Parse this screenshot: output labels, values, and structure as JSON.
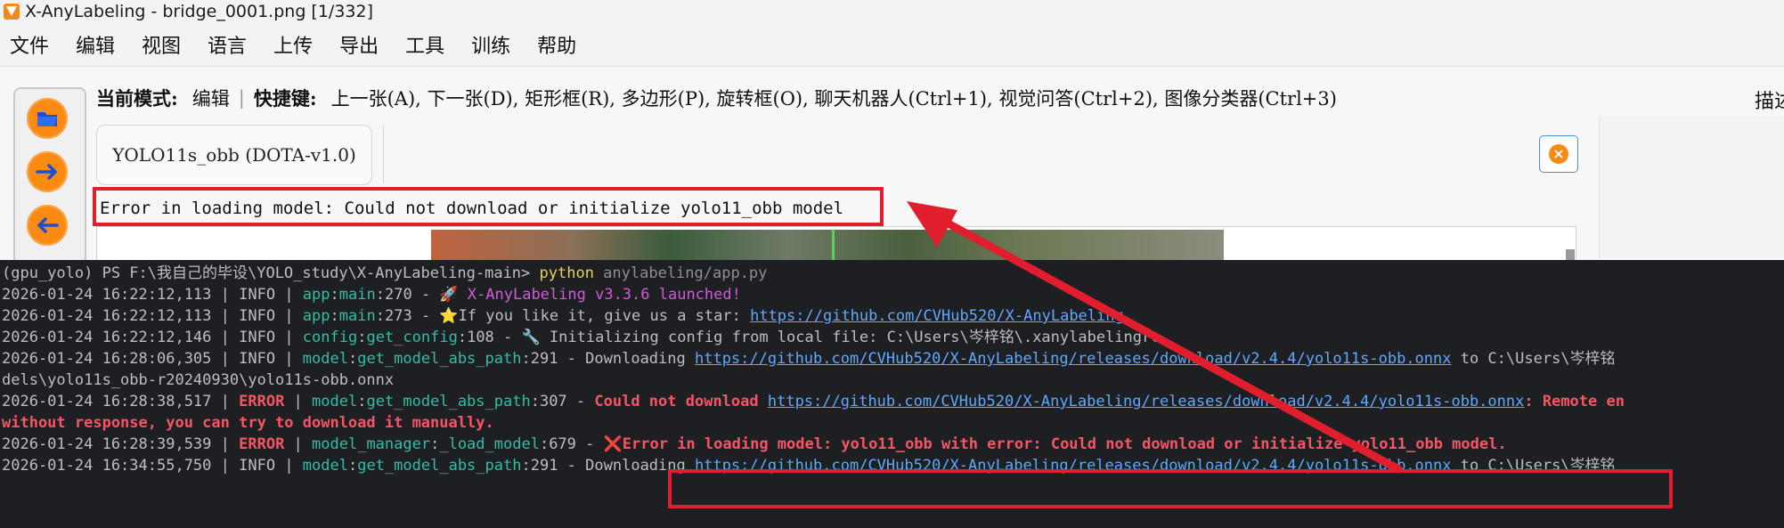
{
  "window": {
    "title": "X-AnyLabeling - bridge_0001.png [1/332]"
  },
  "menu": {
    "items": [
      "文件",
      "编辑",
      "视图",
      "语言",
      "上传",
      "导出",
      "工具",
      "训练",
      "帮助"
    ]
  },
  "toolbar": {
    "buttons": [
      {
        "icon": "folder-icon"
      },
      {
        "icon": "arrow-right-icon"
      },
      {
        "icon": "arrow-left-icon"
      }
    ],
    "accent_color": "#fb8a12"
  },
  "mode_bar": {
    "mode_label": "当前模式:",
    "mode_value": "编辑",
    "shortcut_label": "快捷键:",
    "shortcuts": "上一张(A), 下一张(D), 矩形框(R), 多边形(P), 旋转框(O), 聊天机器人(Ctrl+1), 视觉问答(Ctrl+2), 图像分类器(Ctrl+3)"
  },
  "model": {
    "name": "YOLO11s_obb (DOTA-v1.0)",
    "error": "Error in loading model: Could not download or initialize yolo11_obb model"
  },
  "right_panel": {
    "label": "描述"
  },
  "terminal": {
    "prompt_prefix": "(gpu_yolo) PS F:\\我自己的毕设\\YOLO_study\\X-AnyLabeling-main> ",
    "command": "python",
    "command_args": " anylabeling/app.py",
    "lines": [
      {
        "ts": "2026-01-24 16:22:12,113",
        "level": "INFO",
        "mod": "app",
        "func": "main",
        "line": "270",
        "msg": "🚀 X-AnyLabeling v3.3.6 launched!"
      },
      {
        "ts": "2026-01-24 16:22:12,113",
        "level": "INFO",
        "mod": "app",
        "func": "main",
        "line": "273",
        "msg_a": "⭐If you like it, give us a star: ",
        "link": "https://github.com/CVHub520/X-AnyLabeling"
      },
      {
        "ts": "2026-01-24 16:22:12,146",
        "level": "INFO",
        "mod": "config",
        "func": "get_config",
        "line": "108",
        "msg": "🔧 Initializing config from local file: C:\\Users\\岑梓铭\\.xanylabelingrc"
      },
      {
        "ts": "2026-01-24 16:28:06,305",
        "level": "INFO",
        "mod": "model",
        "func": "get_model_abs_path",
        "line": "291",
        "msg_a": "Downloading ",
        "link": "https://github.com/CVHub520/X-AnyLabeling/releases/download/v2.4.4/yolo11s-obb.onnx",
        "msg_b": " to C:\\Users\\岑梓铭"
      },
      {
        "cont": "dels\\yolo11s_obb-r20240930\\yolo11s-obb.onnx"
      },
      {
        "ts": "2026-01-24 16:28:38,517",
        "level": "ERROR",
        "mod": "model",
        "func": "get_model_abs_path",
        "line": "307",
        "msg_a": "Could not download ",
        "link": "https://github.com/CVHub520/X-AnyLabeling/releases/download/v2.4.4/yolo11s-obb.onnx",
        "msg_b": ": Remote en"
      },
      {
        "cont": " without response, you can try to download it manually."
      },
      {
        "ts": "2026-01-24 16:28:39,539",
        "level": "ERROR",
        "mod": "model_manager",
        "func": "_load_model",
        "line": "679",
        "msg": "❌Error in loading model: yolo11_obb with error: Could not download or initialize yolo11_obb model."
      },
      {
        "ts": "2026-01-24 16:34:55,750",
        "level": "INFO",
        "mod": "model",
        "func": "get_model_abs_path",
        "line": "291",
        "msg_a": "Downloading ",
        "link": "https://github.com/CVHub520/X-AnyLabeling/releases/download/v2.4.4/yolo11s-obb.onnx",
        "msg_b": " to C:\\Users\\岑梓铭"
      }
    ]
  },
  "annotation": {
    "color": "#e01e2e"
  }
}
